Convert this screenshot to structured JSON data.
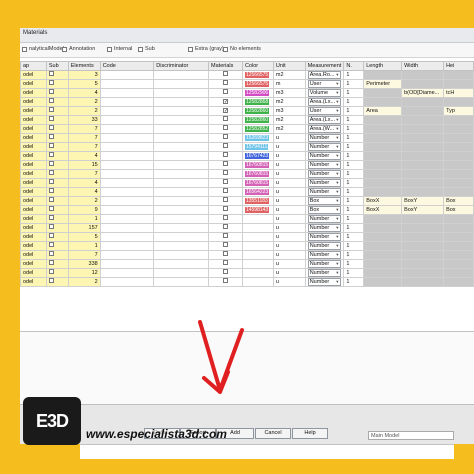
{
  "window": {
    "title": "Materials"
  },
  "options": [
    {
      "label": "nalyticalModel",
      "checked": false
    },
    {
      "label": "Annotation",
      "checked": false
    },
    {
      "label": "Internal",
      "checked": false
    },
    {
      "label": "Sub",
      "checked": false
    },
    {
      "label": "Extra (gray)",
      "checked": false
    },
    {
      "label": "No elements",
      "checked": false
    }
  ],
  "columns": [
    "ap",
    "Sub",
    "Elements",
    "Code",
    "Discriminator",
    "Materials",
    "Color",
    "Unit",
    "Measurement",
    "N.",
    "Length",
    "Width",
    "Hei"
  ],
  "rows": [
    {
      "type": "odel",
      "elements": "3",
      "mat": false,
      "color": "12566575",
      "colorHex": "#e06262",
      "unit": "m2",
      "meas": "Area.Ro...",
      "n": "1",
      "len": "",
      "wid": "",
      "hei": ""
    },
    {
      "type": "odel",
      "elements": "5",
      "mat": false,
      "color": "12566575",
      "colorHex": "#e06262",
      "unit": "m",
      "meas": "User",
      "n": "1",
      "len": "Perimeter",
      "wid": "",
      "hei": ""
    },
    {
      "type": "odel",
      "elements": "4",
      "mat": false,
      "color": "12582906",
      "colorHex": "#d24cc4",
      "unit": "m3",
      "meas": "Volume",
      "n": "1",
      "len": "",
      "wid": "b(OD[Diame...",
      "hei": "tcH"
    },
    {
      "type": "odel",
      "elements": "2",
      "mat": true,
      "color": "12582868",
      "colorHex": "#3fb24a",
      "unit": "m2",
      "meas": "Area.(Lx...",
      "n": "1",
      "len": "",
      "wid": "",
      "hei": ""
    },
    {
      "type": "odel",
      "elements": "2",
      "mat": true,
      "color": "12582860",
      "colorHex": "#3fb24a",
      "unit": "m3",
      "meas": "User",
      "n": "1",
      "len": "Area",
      "wid": "",
      "hei": "Typ"
    },
    {
      "type": "odel",
      "elements": "33",
      "mat": false,
      "color": "12582860",
      "colorHex": "#3fb24a",
      "unit": "m2",
      "meas": "Area.(Lx...",
      "n": "1",
      "len": "",
      "wid": "",
      "hei": ""
    },
    {
      "type": "odel",
      "elements": "7",
      "mat": false,
      "color": "12582852",
      "colorHex": "#3fb24a",
      "unit": "m2",
      "meas": "Area.(W...",
      "n": "1",
      "len": "",
      "wid": "",
      "hei": ""
    },
    {
      "type": "odel",
      "elements": "7",
      "mat": false,
      "color": "15269823",
      "colorHex": "#6fc4ea",
      "unit": "u",
      "meas": "Number",
      "n": "1",
      "len": "",
      "wid": "",
      "hei": ""
    },
    {
      "type": "odel",
      "elements": "7",
      "mat": false,
      "color": "15794111",
      "colorHex": "#6fc4ea",
      "unit": "u",
      "meas": "Number",
      "n": "1",
      "len": "",
      "wid": "",
      "hei": ""
    },
    {
      "type": "odel",
      "elements": "4",
      "mat": false,
      "color": "16767423",
      "colorHex": "#4466dd",
      "unit": "u",
      "meas": "Number",
      "n": "1",
      "len": "",
      "wid": "",
      "hei": ""
    },
    {
      "type": "odel",
      "elements": "15",
      "mat": false,
      "color": "16760815",
      "colorHex": "#d462b6",
      "unit": "u",
      "meas": "Number",
      "n": "1",
      "len": "",
      "wid": "",
      "hei": ""
    },
    {
      "type": "odel",
      "elements": "7",
      "mat": false,
      "color": "16760815",
      "colorHex": "#d462b6",
      "unit": "u",
      "meas": "Number",
      "n": "1",
      "len": "",
      "wid": "",
      "hei": ""
    },
    {
      "type": "odel",
      "elements": "4",
      "mat": false,
      "color": "16760815",
      "colorHex": "#d462b6",
      "unit": "u",
      "meas": "Number",
      "n": "1",
      "len": "",
      "wid": "",
      "hei": ""
    },
    {
      "type": "odel",
      "elements": "4",
      "mat": false,
      "color": "16564223",
      "colorHex": "#d462b6",
      "unit": "u",
      "meas": "Number",
      "n": "1",
      "len": "",
      "wid": "",
      "hei": ""
    },
    {
      "type": "odel",
      "elements": "2",
      "mat": false,
      "color": "13551183",
      "colorHex": "#e06262",
      "unit": "u",
      "meas": "Box",
      "n": "1",
      "len": "BoxX",
      "wid": "BoxY",
      "hei": "Box"
    },
    {
      "type": "odel",
      "elements": "9",
      "mat": false,
      "color": "14598143",
      "colorHex": "#e06262",
      "unit": "u",
      "meas": "Box",
      "n": "1",
      "len": "BoxX",
      "wid": "BoxY",
      "hei": "Box"
    },
    {
      "type": "odel",
      "elements": "1",
      "mat": false,
      "color": "",
      "colorHex": "",
      "unit": "u",
      "meas": "Number",
      "n": "1",
      "len": "",
      "wid": "",
      "hei": ""
    },
    {
      "type": "odel",
      "elements": "157",
      "mat": false,
      "color": "",
      "colorHex": "",
      "unit": "u",
      "meas": "Number",
      "n": "1",
      "len": "",
      "wid": "",
      "hei": ""
    },
    {
      "type": "odel",
      "elements": "5",
      "mat": false,
      "color": "",
      "colorHex": "",
      "unit": "u",
      "meas": "Number",
      "n": "1",
      "len": "",
      "wid": "",
      "hei": ""
    },
    {
      "type": "odel",
      "elements": "1",
      "mat": false,
      "color": "",
      "colorHex": "",
      "unit": "u",
      "meas": "Number",
      "n": "1",
      "len": "",
      "wid": "",
      "hei": ""
    },
    {
      "type": "odel",
      "elements": "7",
      "mat": false,
      "color": "",
      "colorHex": "",
      "unit": "u",
      "meas": "Number",
      "n": "1",
      "len": "",
      "wid": "",
      "hei": ""
    },
    {
      "type": "odel",
      "elements": "338",
      "mat": false,
      "color": "",
      "colorHex": "",
      "unit": "u",
      "meas": "Number",
      "n": "1",
      "len": "",
      "wid": "",
      "hei": ""
    },
    {
      "type": "odel",
      "elements": "12",
      "mat": false,
      "color": "",
      "colorHex": "",
      "unit": "u",
      "meas": "Number",
      "n": "1",
      "len": "",
      "wid": "",
      "hei": ""
    },
    {
      "type": "odel",
      "elements": "2",
      "mat": false,
      "color": "",
      "colorHex": "",
      "unit": "u",
      "meas": "Number",
      "n": "1",
      "len": "",
      "wid": "",
      "hei": ""
    }
  ],
  "buttons": {
    "first": "Defa...",
    "export": "Export",
    "add": "Add",
    "cancel": "Cancel",
    "help": "Help"
  },
  "branding": {
    "logo": "E3D",
    "url": "www.especialista3d.com"
  },
  "viewSelector": "Main Model",
  "colors": {
    "background": "#f5be1e",
    "rowHighlight": "#fdf6b2",
    "arrow": "#e02020"
  }
}
